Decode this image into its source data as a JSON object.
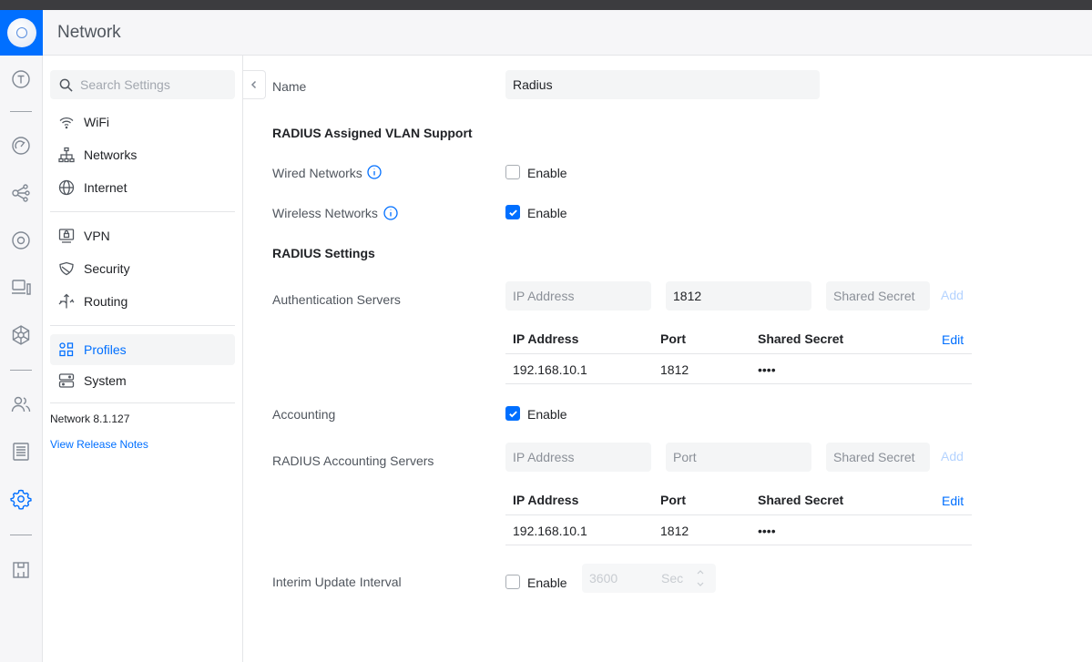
{
  "app": {
    "title": "Network"
  },
  "search": {
    "placeholder": "Search Settings"
  },
  "nav": {
    "items": [
      {
        "label": "WiFi",
        "icon": "wifi-icon"
      },
      {
        "label": "Networks",
        "icon": "networks-icon"
      },
      {
        "label": "Internet",
        "icon": "globe-icon"
      },
      {
        "label": "VPN",
        "icon": "vpn-icon"
      },
      {
        "label": "Security",
        "icon": "shield-icon"
      },
      {
        "label": "Routing",
        "icon": "routing-icon"
      },
      {
        "label": "Profiles",
        "icon": "profiles-icon"
      },
      {
        "label": "System",
        "icon": "system-icon"
      }
    ],
    "active": "Profiles",
    "version": "Network 8.1.127",
    "release_notes": "View Release Notes"
  },
  "form": {
    "name_label": "Name",
    "name_value": "Radius",
    "vlan_section": "RADIUS Assigned VLAN Support",
    "wired_label": "Wired Networks",
    "wired_enable": "Enable",
    "wired_checked": false,
    "wireless_label": "Wireless Networks",
    "wireless_enable": "Enable",
    "wireless_checked": true,
    "settings_section": "RADIUS Settings",
    "auth_label": "Authentication Servers",
    "auth_ip_placeholder": "IP Address",
    "auth_port_value": "1812",
    "auth_secret_placeholder": "Shared Secret",
    "auth_add": "Add",
    "auth_table": {
      "headers": [
        "IP Address",
        "Port",
        "Shared Secret"
      ],
      "edit": "Edit",
      "rows": [
        [
          "192.168.10.1",
          "1812",
          "••••"
        ]
      ]
    },
    "accounting_label": "Accounting",
    "accounting_enable": "Enable",
    "accounting_checked": true,
    "acct_servers_label": "RADIUS Accounting Servers",
    "acct_ip_placeholder": "IP Address",
    "acct_port_placeholder": "Port",
    "acct_secret_placeholder": "Shared Secret",
    "acct_add": "Add",
    "acct_table": {
      "headers": [
        "IP Address",
        "Port",
        "Shared Secret"
      ],
      "edit": "Edit",
      "rows": [
        [
          "192.168.10.1",
          "1812",
          "••••"
        ]
      ]
    },
    "interim_label": "Interim Update Interval",
    "interim_enable": "Enable",
    "interim_checked": false,
    "interim_value": "3600",
    "interim_unit": "Sec"
  },
  "colors": {
    "accent": "#006fff",
    "text": "#212327",
    "muted": "#50565e"
  }
}
